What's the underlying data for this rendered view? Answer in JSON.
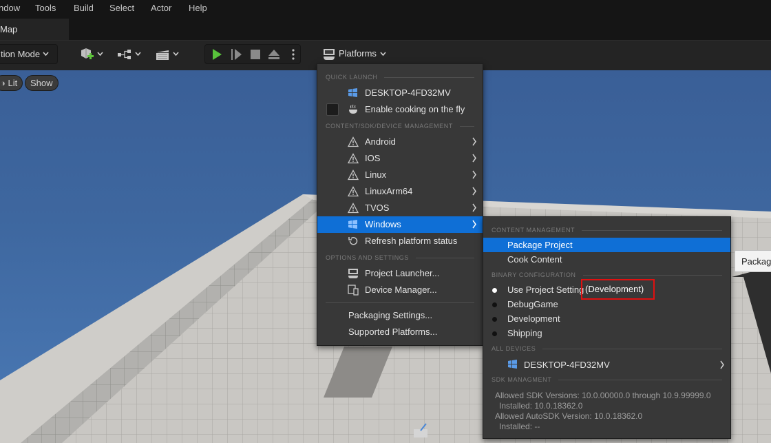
{
  "menubar": {
    "items": [
      "ndow",
      "Tools",
      "Build",
      "Select",
      "Actor",
      "Help"
    ]
  },
  "tab": {
    "label": "Map"
  },
  "toolbar": {
    "mode_label": "tion Mode",
    "platforms_label": "Platforms"
  },
  "viewport": {
    "lit_label": "Lit",
    "show_label": "Show"
  },
  "platforms_menu": {
    "quick_launch_header": "QUICK LAUNCH",
    "quick_launch_device": "DESKTOP-4FD32MV",
    "cook_on_fly_label": "Enable cooking on the fly",
    "content_sdk_header": "CONTENT/SDK/DEVICE MANAGEMENT",
    "platforms": [
      "Android",
      "IOS",
      "Linux",
      "LinuxArm64",
      "TVOS",
      "Windows"
    ],
    "refresh_label": "Refresh platform status",
    "options_header": "OPTIONS AND SETTINGS",
    "project_launcher_label": "Project Launcher...",
    "device_manager_label": "Device Manager...",
    "packaging_settings_label": "Packaging Settings...",
    "supported_platforms_label": "Supported Platforms..."
  },
  "windows_submenu": {
    "content_header": "CONTENT MANAGEMENT",
    "package_project_label": "Package Project",
    "cook_content_label": "Cook Content",
    "binary_header": "BINARY CONFIGURATION",
    "binary_options": [
      "Use Project Setting",
      "DebugGame",
      "Development",
      "Shipping"
    ],
    "project_setting_value": "(Development)",
    "all_devices_header": "ALL DEVICES",
    "device_name": "DESKTOP-4FD32MV",
    "sdk_header": "SDK MANAGMENT",
    "sdk_lines": [
      "Allowed SDK Versions: 10.0.00000.0 through 10.9.99999.0",
      "Installed: 10.0.18362.0",
      "Allowed AutoSDK Version: 10.0.18362.0",
      "Installed: --"
    ]
  },
  "tooltip": {
    "text": "Packag"
  },
  "colors": {
    "highlight": "#0f6fd6",
    "callout": "#e01010",
    "menu_bg": "#383838",
    "sky": "#3e679f"
  }
}
